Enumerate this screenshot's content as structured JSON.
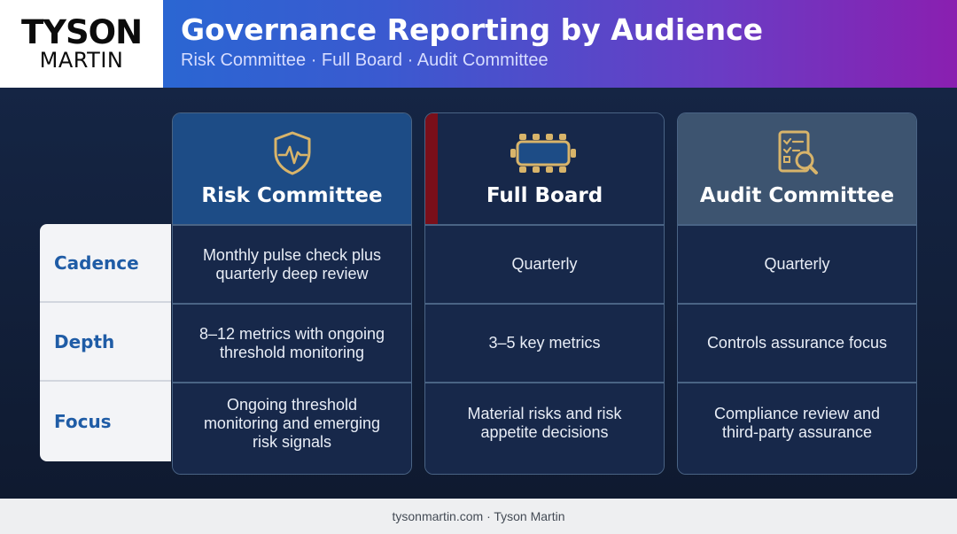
{
  "brand": {
    "logo_top": "TYSON",
    "logo_bottom": "MARTIN"
  },
  "header": {
    "title": "Governance Reporting by Audience",
    "subtitle": "Risk Committee · Full Board · Audit Committee"
  },
  "rows": [
    "Cadence",
    "Depth",
    "Focus"
  ],
  "columns": [
    {
      "title": "Risk Committee",
      "icon": "shield-pulse-icon",
      "cells": [
        "Monthly pulse check plus quarterly deep review",
        "8–12 metrics with ongoing threshold monitoring",
        "Ongoing threshold monitoring and emerging risk signals"
      ]
    },
    {
      "title": "Full Board",
      "icon": "boardroom-table-icon",
      "cells": [
        "Quarterly",
        "3–5 key metrics",
        "Material risks and risk appetite decisions"
      ]
    },
    {
      "title": "Audit Committee",
      "icon": "checklist-magnifier-icon",
      "cells": [
        "Quarterly",
        "Controls assurance focus",
        "Compliance review and third-party assurance"
      ]
    }
  ],
  "colors": {
    "accent_gold": "#d8b46a",
    "label_blue": "#1f5ca6",
    "board_accent": "#7a0f1a"
  },
  "footer": {
    "text": "tysonmartin.com · Tyson Martin"
  }
}
